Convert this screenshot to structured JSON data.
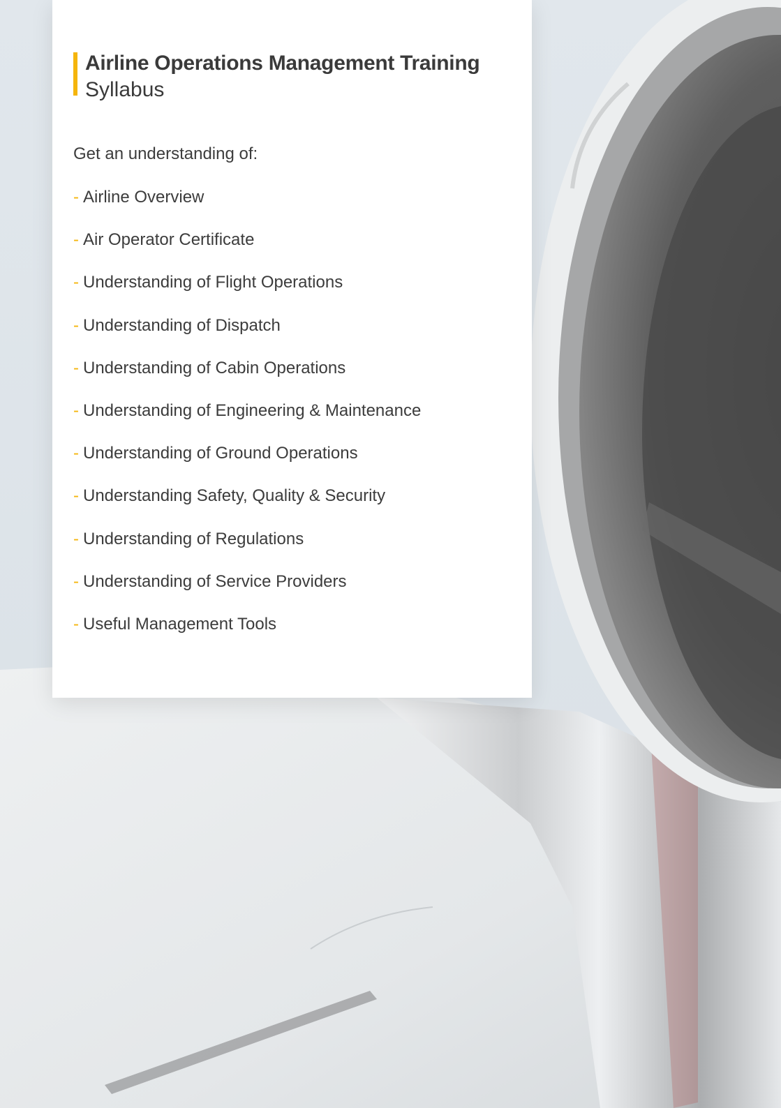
{
  "header": {
    "title": "Airline Operations Management Training",
    "subtitle": "Syllabus"
  },
  "intro": "Get an understanding of:",
  "bullet_marker": "-",
  "items": [
    "Airline Overview",
    "Air Operator Certificate",
    "Understanding of Flight Operations",
    "Understanding of Dispatch",
    "Understanding of Cabin Operations",
    "Understanding of Engineering & Maintenance",
    "Understanding of Ground Operations",
    "Understanding Safety, Quality & Security",
    "Understanding of Regulations",
    "Understanding of Service Providers",
    "Useful Management Tools"
  ],
  "colors": {
    "accent": "#f5b50c",
    "text": "#3a3a3a",
    "card": "#ffffff"
  }
}
